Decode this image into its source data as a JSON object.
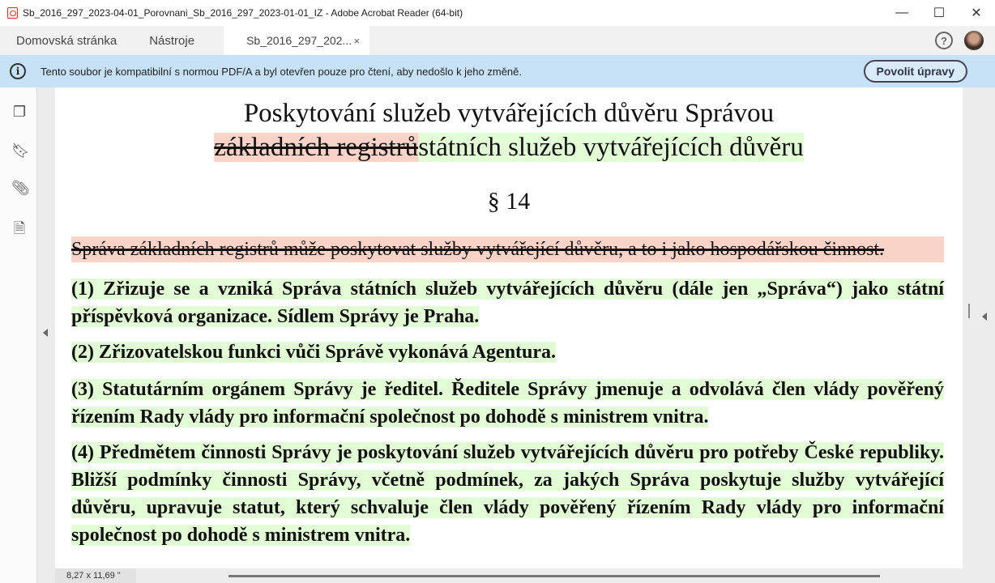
{
  "window": {
    "title": "Sb_2016_297_2023-04-01_Porovnani_Sb_2016_297_2023-01-01_IZ - Adobe Acrobat Reader (64-bit)",
    "minimize": "—",
    "maximize": "☐",
    "close": "✕"
  },
  "tabs": [
    {
      "label": "Domovská stránka"
    },
    {
      "label": "Nástroje"
    },
    {
      "label": "Sb_2016_297_202...",
      "close": "×",
      "active": true
    }
  ],
  "header": {
    "help": "?"
  },
  "infobar": {
    "message": "Tento soubor je kompatibilní s normou PDF/A a byl otevřen pouze pro čtení, aby nedošlo k jeho změně.",
    "button": "Povolit úpravy"
  },
  "sidebar": {
    "icons": [
      "pages-icon",
      "bookmark-icon",
      "attachment-icon",
      "document-info-icon"
    ]
  },
  "document": {
    "title_line1": "Poskytování služeb vytvářejících důvěru Správou",
    "title_deleted": "základních registrů",
    "title_inserted": "státních služeb vytvářejících důvěru",
    "section": "§ 14",
    "deleted_paragraph": "Správa základních registrů může poskytovat služby vytvářející důvěru, a to i jako hospodářskou činnost.",
    "paragraphs": [
      "(1) Zřizuje se a vzniká Správa státních služeb vytvářejících důvěru (dále jen „Správa“) jako státní příspěvková organizace. Sídlem Správy je Praha.",
      "(2) Zřizovatelskou funkci vůči Správě vykonává Agentura.",
      "(3) Statutárním orgánem Správy je ředitel. Ředitele Správy jmenuje a odvolává člen vlády pověřený řízením Rady vlády pro informační společnost po dohodě s ministrem vnitra.",
      "(4) Předmětem činnosti Správy je poskytování služeb vytvářejících důvěru pro potřeby České republiky. Bližší podmínky činnosti Správy, včetně podmínek, za jakých Správa poskytuje služby vytvářející důvěru, upravuje statut, který schvaluje člen vlády pověřený řízením Rady vlády pro informační společnost po dohodě s ministrem vnitra."
    ]
  },
  "status": {
    "page_size": "8,27 x 11,69 \""
  },
  "colors": {
    "deleted": "#fad3c8",
    "inserted": "#e2fcd6",
    "infobar": "#c7e1f6"
  }
}
